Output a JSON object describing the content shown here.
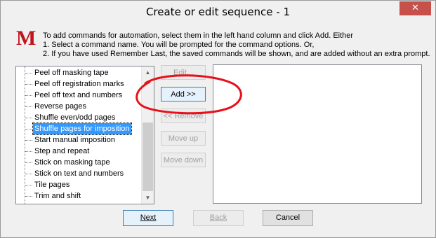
{
  "window": {
    "title": "Create or edit sequence - 1",
    "close_label": "✕",
    "colors": {
      "logo": "#c0151c",
      "selection": "#3399ff",
      "annotation_ring": "#e8101a",
      "close_button": "#c7504b"
    }
  },
  "logo": {
    "text": "M"
  },
  "instructions": {
    "line1": "To add commands for automation, select them in the left hand column and click Add. Either",
    "line2": "1. Select a command name. You will be prompted for the command options. Or,",
    "line3": "2. If you have used Remember Last, the saved commands will be shown, and are added without an extra prompt."
  },
  "command_list": {
    "items": [
      "Peel off masking tape",
      "Peel off registration marks",
      "Peel off text and numbers",
      "Reverse pages",
      "Shuffle even/odd pages",
      "Shuffle pages for imposition",
      "Start manual imposition",
      "Step and repeat",
      "Stick on masking tape",
      "Stick on text and numbers",
      "Tile pages",
      "Trim and shift"
    ],
    "selected_item": "Shuffle pages for imposition"
  },
  "buttons": {
    "edit": "Edit...",
    "add": "Add >>",
    "remove": "<< Remove",
    "move_up": "Move up",
    "move_down": "Move down"
  },
  "footer": {
    "next": "Next",
    "back": "Back",
    "cancel": "Cancel"
  },
  "icons": {
    "scroll_up": "chevron-up-icon",
    "scroll_down": "chevron-down-icon",
    "close": "close-icon"
  }
}
